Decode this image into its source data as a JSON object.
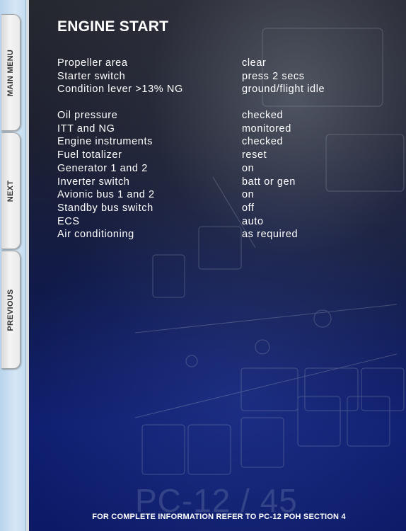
{
  "nav": {
    "tabs": [
      {
        "label": "MAIN MENU"
      },
      {
        "label": "NEXT"
      },
      {
        "label": "PREVIOUS"
      }
    ]
  },
  "page": {
    "title": "ENGINE START",
    "checklist": [
      {
        "item": "Propeller area",
        "action": "clear"
      },
      {
        "item": "Starter switch",
        "action": "press 2 secs"
      },
      {
        "item": "Condition lever >13% NG",
        "action": "ground/flight idle"
      },
      {
        "item": "Oil pressure",
        "action": "checked"
      },
      {
        "item": "ITT and NG",
        "action": "monitored"
      },
      {
        "item": "Engine instruments",
        "action": "checked"
      },
      {
        "item": "Fuel totalizer",
        "action": "reset"
      },
      {
        "item": "Generator 1 and 2",
        "action": "on"
      },
      {
        "item": "Inverter switch",
        "action": "batt or gen"
      },
      {
        "item": "Avionic bus 1 and 2",
        "action": "on"
      },
      {
        "item": "Standby bus switch",
        "action": "off"
      },
      {
        "item": "ECS",
        "action": "auto"
      },
      {
        "item": "Air conditioning",
        "action": "as required"
      }
    ],
    "watermark": "PC-12 / 45",
    "footer": "FOR COMPLETE INFORMATION REFER TO PC-12 POH SECTION 4"
  },
  "colors": {
    "rail": "#c4dcef",
    "tab": "#eeeeee",
    "panel_top": "#262830",
    "panel_bottom": "#0c1a66",
    "text": "#ffffff"
  }
}
